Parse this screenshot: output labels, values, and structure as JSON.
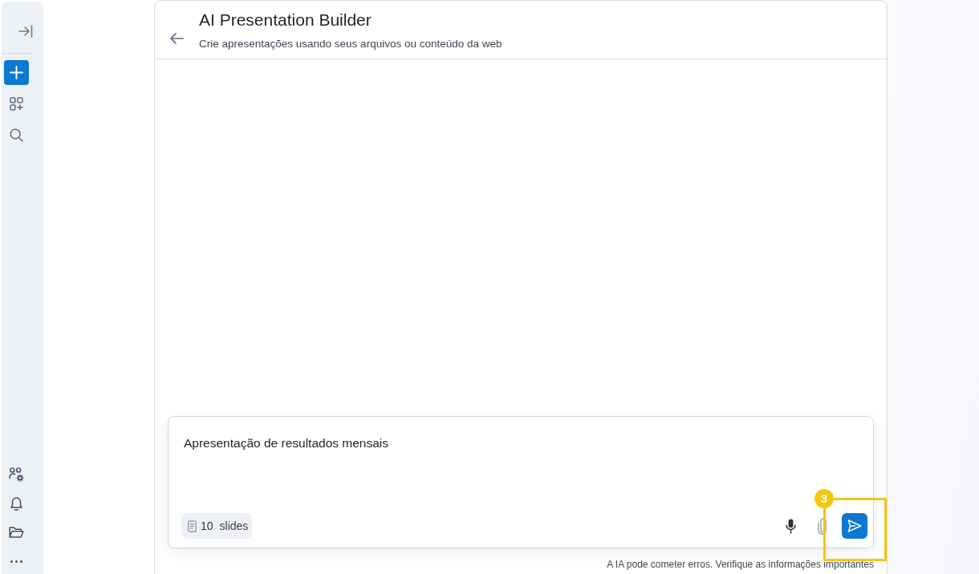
{
  "sidebar": {
    "top_items": [
      {
        "kind": "collapse"
      },
      {
        "kind": "new"
      },
      {
        "kind": "apps"
      },
      {
        "kind": "search"
      }
    ],
    "bottom_items": [
      {
        "kind": "team_settings"
      },
      {
        "kind": "notifications"
      },
      {
        "kind": "files"
      },
      {
        "kind": "more"
      }
    ]
  },
  "header": {
    "title": "AI Presentation Builder",
    "subtitle": "Crie apresentações usando seus arquivos ou conteúdo da web"
  },
  "composer": {
    "value": "Apresentação de resultados mensais",
    "slides_chip": {
      "count": "10",
      "label": "slides"
    },
    "actions": [
      {
        "kind": "mic",
        "disabled": false
      },
      {
        "kind": "attach",
        "disabled": true
      },
      {
        "kind": "send",
        "disabled": false
      }
    ]
  },
  "annotation": {
    "number": "3"
  },
  "footer": {
    "disclaimer": "A IA pode cometer erros. Verifique as informações importantes"
  }
}
